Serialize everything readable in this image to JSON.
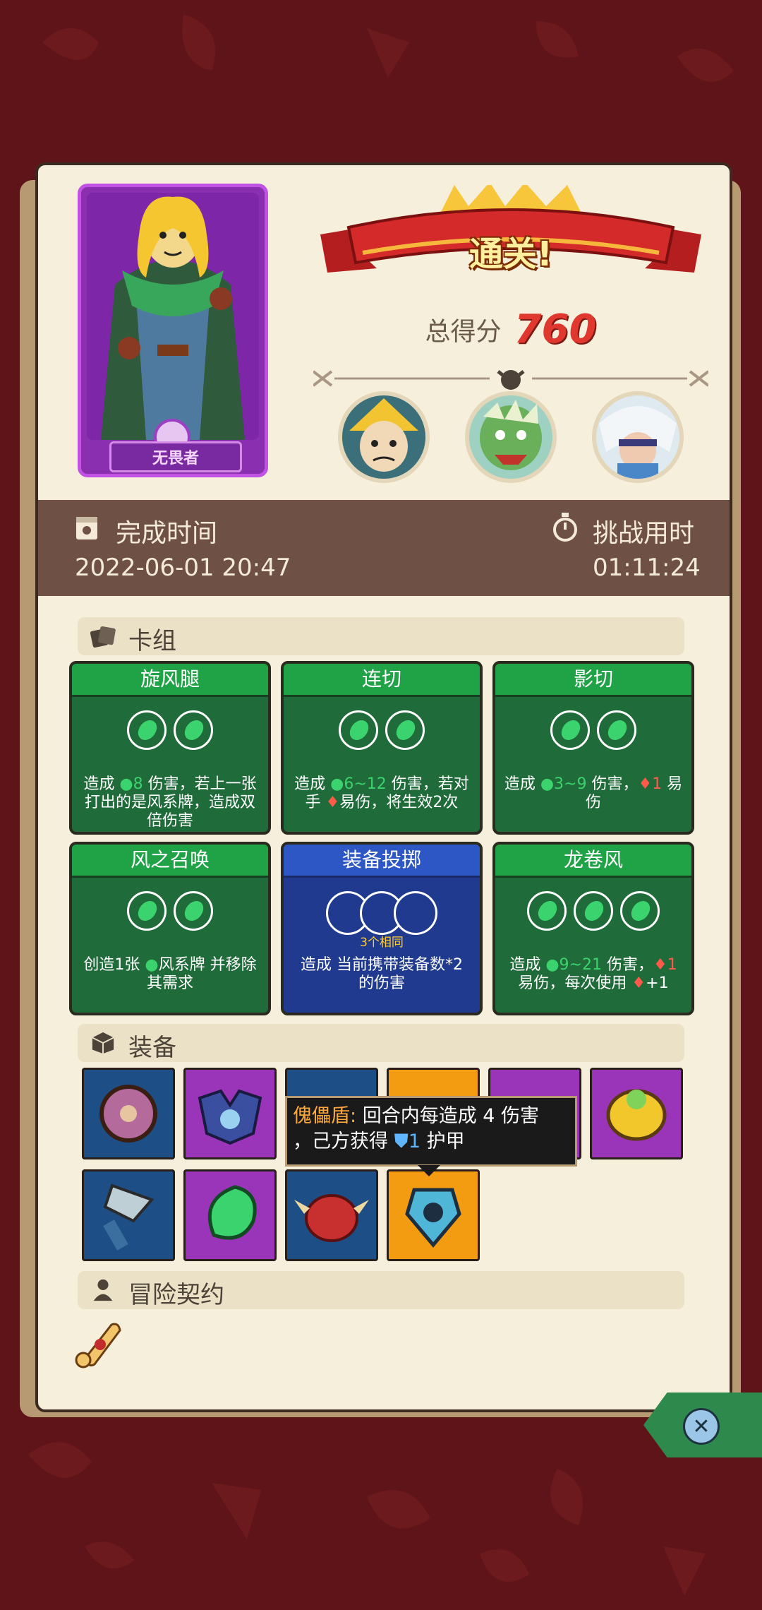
{
  "result": {
    "banner": "通关!",
    "score_label": "总得分",
    "score_value": "760"
  },
  "hero": {
    "title": "无畏者"
  },
  "times": {
    "finish_label": "完成时间",
    "finish_value": "2022-06-01 20:47",
    "duration_label": "挑战用时",
    "duration_value": "01:11:24"
  },
  "sections": {
    "deck": "卡组",
    "equipment": "装备",
    "contract": "冒险契约"
  },
  "cards": [
    {
      "name": "旋风腿",
      "cost": 2,
      "desc_pre": "造成 ",
      "num1": "8",
      "desc_mid": " 伤害，若上一张打出的是风系牌，造成双倍伤害"
    },
    {
      "name": "连切",
      "cost": 2,
      "desc_pre": "造成 ",
      "num1": "6~12",
      "desc_mid": " 伤害，若对手 ",
      "desc_post": "易伤，将生效2次"
    },
    {
      "name": "影切",
      "cost": 2,
      "desc_pre": "造成 ",
      "num1": "3~9",
      "desc_mid": " 伤害，",
      "num2": "1",
      "desc_post": " 易伤"
    },
    {
      "name": "风之召唤",
      "cost": 2,
      "desc_pre": "创造1张 ",
      "desc_mid": "风系牌 并移除其需求"
    },
    {
      "name": "装备投掷",
      "cost": 3,
      "cost_label": "3个相同",
      "desc": "造成 当前携带装备数*2 的伤害"
    },
    {
      "name": "龙卷风",
      "cost": 3,
      "desc_pre": "造成 ",
      "num1": "9~21",
      "desc_mid": " 伤害，",
      "num2": "1",
      "desc_post": " 易伤，每次使用 ",
      "num3": "+1"
    }
  ],
  "tooltip": {
    "name": "傀儡盾:",
    "text1": " 回合内每造成 4 伤害",
    "text2": "，己方获得 ",
    "value": "1",
    "text3": " 护甲"
  },
  "colors": {
    "background": "#5e1418",
    "panel": "#f6efdc",
    "score": "#e0372e",
    "card_green": "#1f6b3a",
    "card_blue": "#1f3a8e"
  }
}
